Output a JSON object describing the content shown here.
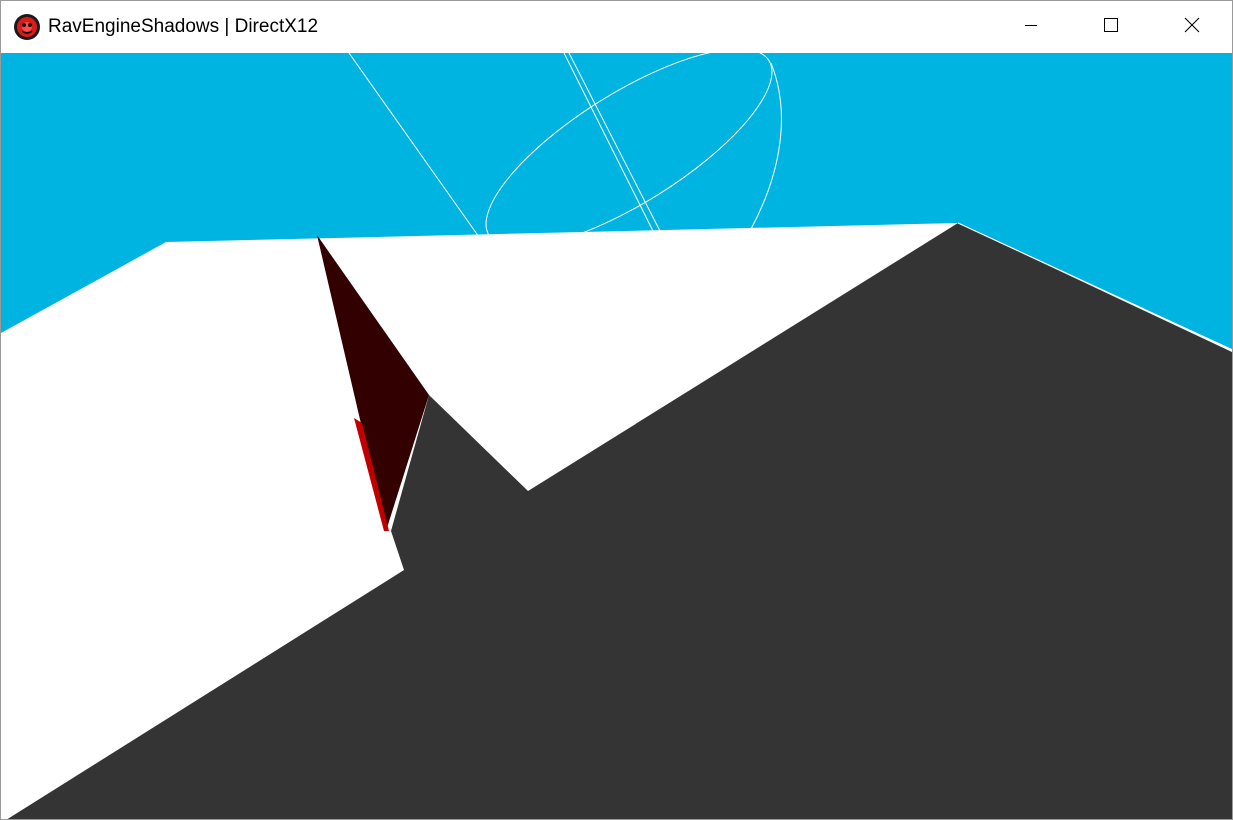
{
  "window": {
    "title": "RavEngineShadows | DirectX12",
    "icon": "raven-engine-logo-icon"
  },
  "caption_buttons": {
    "minimize": "minimize-icon",
    "maximize": "maximize-icon",
    "close": "close-icon"
  },
  "scene": {
    "sky_color": "#00b4e1",
    "lit_plane_color": "#ffffff",
    "shadow_color": "#343434",
    "cube_face_color": "#330000",
    "cube_edge_color": "#c00000",
    "gizmo_line_color": "#ffffff"
  }
}
